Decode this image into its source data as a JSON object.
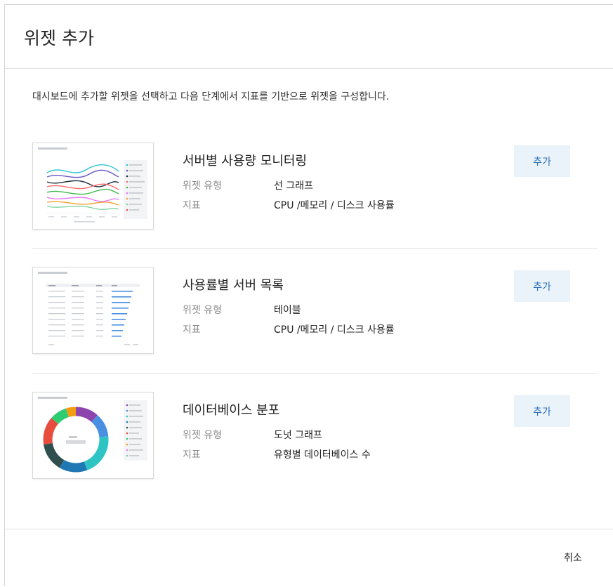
{
  "dialog": {
    "title": "위젯 추가",
    "description": "대시보드에 추가할 위젯을 선택하고 다음 단계에서 지표를 기반으로 위젯을 구성합니다.",
    "cancel_label": "취소"
  },
  "widgets": [
    {
      "title": "서버별 사용량 모니터링",
      "type_label": "위젯 유형",
      "type_value": "선 그래프",
      "metric_label": "지표",
      "metric_value": "CPU /메모리 / 디스크 사용률",
      "add_label": "추가",
      "thumbnail": "line-chart-preview"
    },
    {
      "title": "사용률별 서버 목록",
      "type_label": "위젯 유형",
      "type_value": "테이블",
      "metric_label": "지표",
      "metric_value": "CPU /메모리 / 디스크 사용률",
      "add_label": "추가",
      "thumbnail": "table-preview"
    },
    {
      "title": "데이터베이스 분포",
      "type_label": "위젯 유형",
      "type_value": "도넛 그래프",
      "metric_label": "지표",
      "metric_value": "유형별 데이터베이스 수",
      "add_label": "추가",
      "thumbnail": "donut-chart-preview"
    }
  ],
  "colors": {
    "add_button_bg": "#eaf2fa",
    "add_button_text": "#2a6fb8",
    "divider": "#e3e3e3",
    "preview_series": [
      "#2ec4d6",
      "#6a5acd",
      "#1f2d3d",
      "#ff6b6b",
      "#3fb950",
      "#e879f9",
      "#f0a030",
      "#7fd4a0"
    ],
    "donut_segments": [
      "#8e44ad",
      "#4a90e2",
      "#2ec4c4",
      "#1f77b4",
      "#2f4f4f",
      "#e74c3c",
      "#2ecc71",
      "#f39c12"
    ]
  }
}
